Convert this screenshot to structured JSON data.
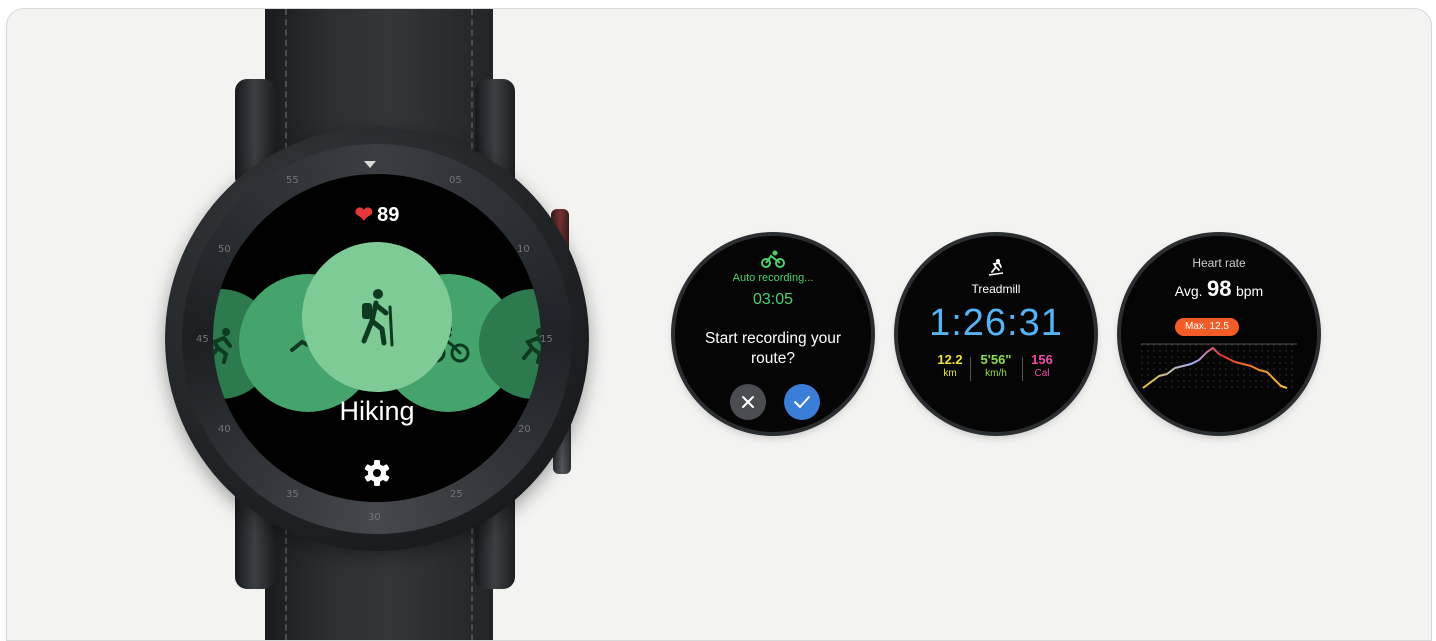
{
  "main_watch": {
    "heart_rate": "89",
    "activity": "Hiking",
    "bezel_numbers": [
      "55",
      "05",
      "10",
      "15",
      "20",
      "25",
      "30",
      "35",
      "40",
      "45",
      "50"
    ]
  },
  "face_recording": {
    "status": "Auto recording...",
    "time": "03:05",
    "prompt_line1": "Start recording your",
    "prompt_line2": "route?"
  },
  "face_treadmill": {
    "title": "Treadmill",
    "time": "1:26:31",
    "stats": [
      {
        "value": "12.2",
        "unit": "km",
        "color": "#e9e33c"
      },
      {
        "value": "5'56\"",
        "unit": "km/h",
        "color": "#8fe04b"
      },
      {
        "value": "156",
        "unit": "Cal",
        "color": "#f04ca6"
      }
    ]
  },
  "face_heart": {
    "title": "Heart rate",
    "avg_prefix": "Avg.",
    "avg_value": "98",
    "avg_unit": "bpm",
    "max_label": "Max. 12.5"
  },
  "colors": {
    "heart": "#e5383b",
    "recording_green": "#4fd06b",
    "treadmill_blue": "#55b4f5",
    "confirm_blue": "#3a7ed8",
    "max_orange": "#f25c27"
  },
  "icons": [
    "heart-icon",
    "hiking-icon",
    "swimming-icon",
    "cycling-icon",
    "running-icon",
    "settings-gear-icon",
    "bicycle-icon",
    "treadmill-icon",
    "close-icon",
    "check-icon"
  ]
}
